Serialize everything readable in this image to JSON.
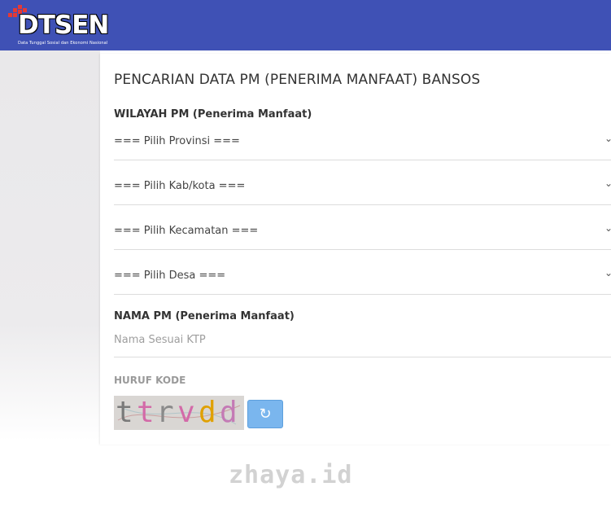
{
  "header": {
    "logo_text": "DTSEN",
    "logo_subtitle": "Data Tunggal Sosial dan Ekonomi Nasional",
    "bg_color": "#3f51b5"
  },
  "main": {
    "title": "PENCARIAN DATA PM (PENERIMA MANFAAT) BANSOS",
    "region_label": "WILAYAH PM (Penerima Manfaat)",
    "selects": [
      {
        "label": "=== Pilih Provinsi ==="
      },
      {
        "label": "=== Pilih Kab/kota ==="
      },
      {
        "label": "=== Pilih Kecamatan ==="
      },
      {
        "label": "=== Pilih Desa ==="
      }
    ],
    "name_label": "NAMA PM (Penerima Manfaat)",
    "name_placeholder": "Nama Sesuai KTP",
    "captcha_label": "HURUF KODE",
    "captcha_text": "ttrvdd",
    "refresh_icon": "refresh-icon",
    "chevron_icon": "chevron-down-icon"
  },
  "watermark": "zhaya.id"
}
